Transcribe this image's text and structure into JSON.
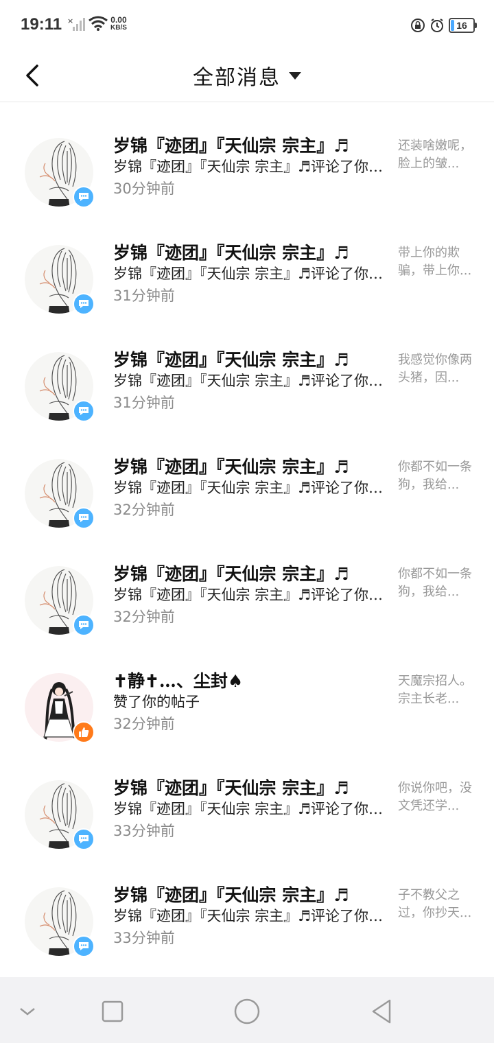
{
  "status_bar": {
    "time": "19:11",
    "net_speed_value": "0.00",
    "net_speed_unit": "KB/S",
    "battery": "16",
    "icons": [
      "signal-icon",
      "wifi-icon",
      "lock-rotation-icon",
      "alarm-icon",
      "battery-icon"
    ]
  },
  "header": {
    "back_icon": "chevron-left-icon",
    "title": "全部消息",
    "dropdown_icon": "caret-down-icon"
  },
  "messages": [
    {
      "name": "岁锦『迹团』『天仙宗 宗主』♬",
      "action": "岁锦『迹团』『天仙宗 宗主』♬评论了你的帖子",
      "time": "30分钟前",
      "preview": "还装啥嫩呢，脸上的皱...",
      "badge": "chat-bubble-icon"
    },
    {
      "name": "岁锦『迹团』『天仙宗 宗主』♬",
      "action": "岁锦『迹团』『天仙宗 宗主』♬评论了你的帖子",
      "time": "31分钟前",
      "preview": "带上你的欺骗，带上你...",
      "badge": "chat-bubble-icon"
    },
    {
      "name": "岁锦『迹团』『天仙宗 宗主』♬",
      "action": "岁锦『迹团』『天仙宗 宗主』♬评论了你的帖子",
      "time": "31分钟前",
      "preview": "我感觉你像两头猪，因...",
      "badge": "chat-bubble-icon"
    },
    {
      "name": "岁锦『迹团』『天仙宗 宗主』♬",
      "action": "岁锦『迹团』『天仙宗 宗主』♬评论了你的帖子",
      "time": "32分钟前",
      "preview": "你都不如一条狗，我给...",
      "badge": "chat-bubble-icon"
    },
    {
      "name": "岁锦『迹团』『天仙宗 宗主』♬",
      "action": "岁锦『迹团』『天仙宗 宗主』♬评论了你的帖子",
      "time": "32分钟前",
      "preview": "你都不如一条狗，我给...",
      "badge": "chat-bubble-icon"
    },
    {
      "name": "✝静✝…、尘封♠",
      "action": "赞了你的帖子",
      "time": "32分钟前",
      "preview": "天魔宗招人。宗主长老...",
      "badge": "thumbs-up-icon"
    },
    {
      "name": "岁锦『迹团』『天仙宗 宗主』♬",
      "action": "岁锦『迹团』『天仙宗 宗主』♬评论了你的帖子",
      "time": "33分钟前",
      "preview": "你说你吧，没文凭还学...",
      "badge": "chat-bubble-icon"
    },
    {
      "name": "岁锦『迹团』『天仙宗 宗主』♬",
      "action": "岁锦『迹团』『天仙宗 宗主』♬评论了你的帖子",
      "time": "33分钟前",
      "preview": "子不教父之过，你抄天...",
      "badge": "chat-bubble-icon"
    }
  ],
  "nav_bar": {
    "icons": [
      "nav-collapse-icon",
      "nav-recents-icon",
      "nav-home-icon",
      "nav-back-icon"
    ]
  },
  "colors": {
    "chat_badge": "#4db3ff",
    "like_badge": "#ff7a1a",
    "nav_bg": "#f2f2f4"
  }
}
